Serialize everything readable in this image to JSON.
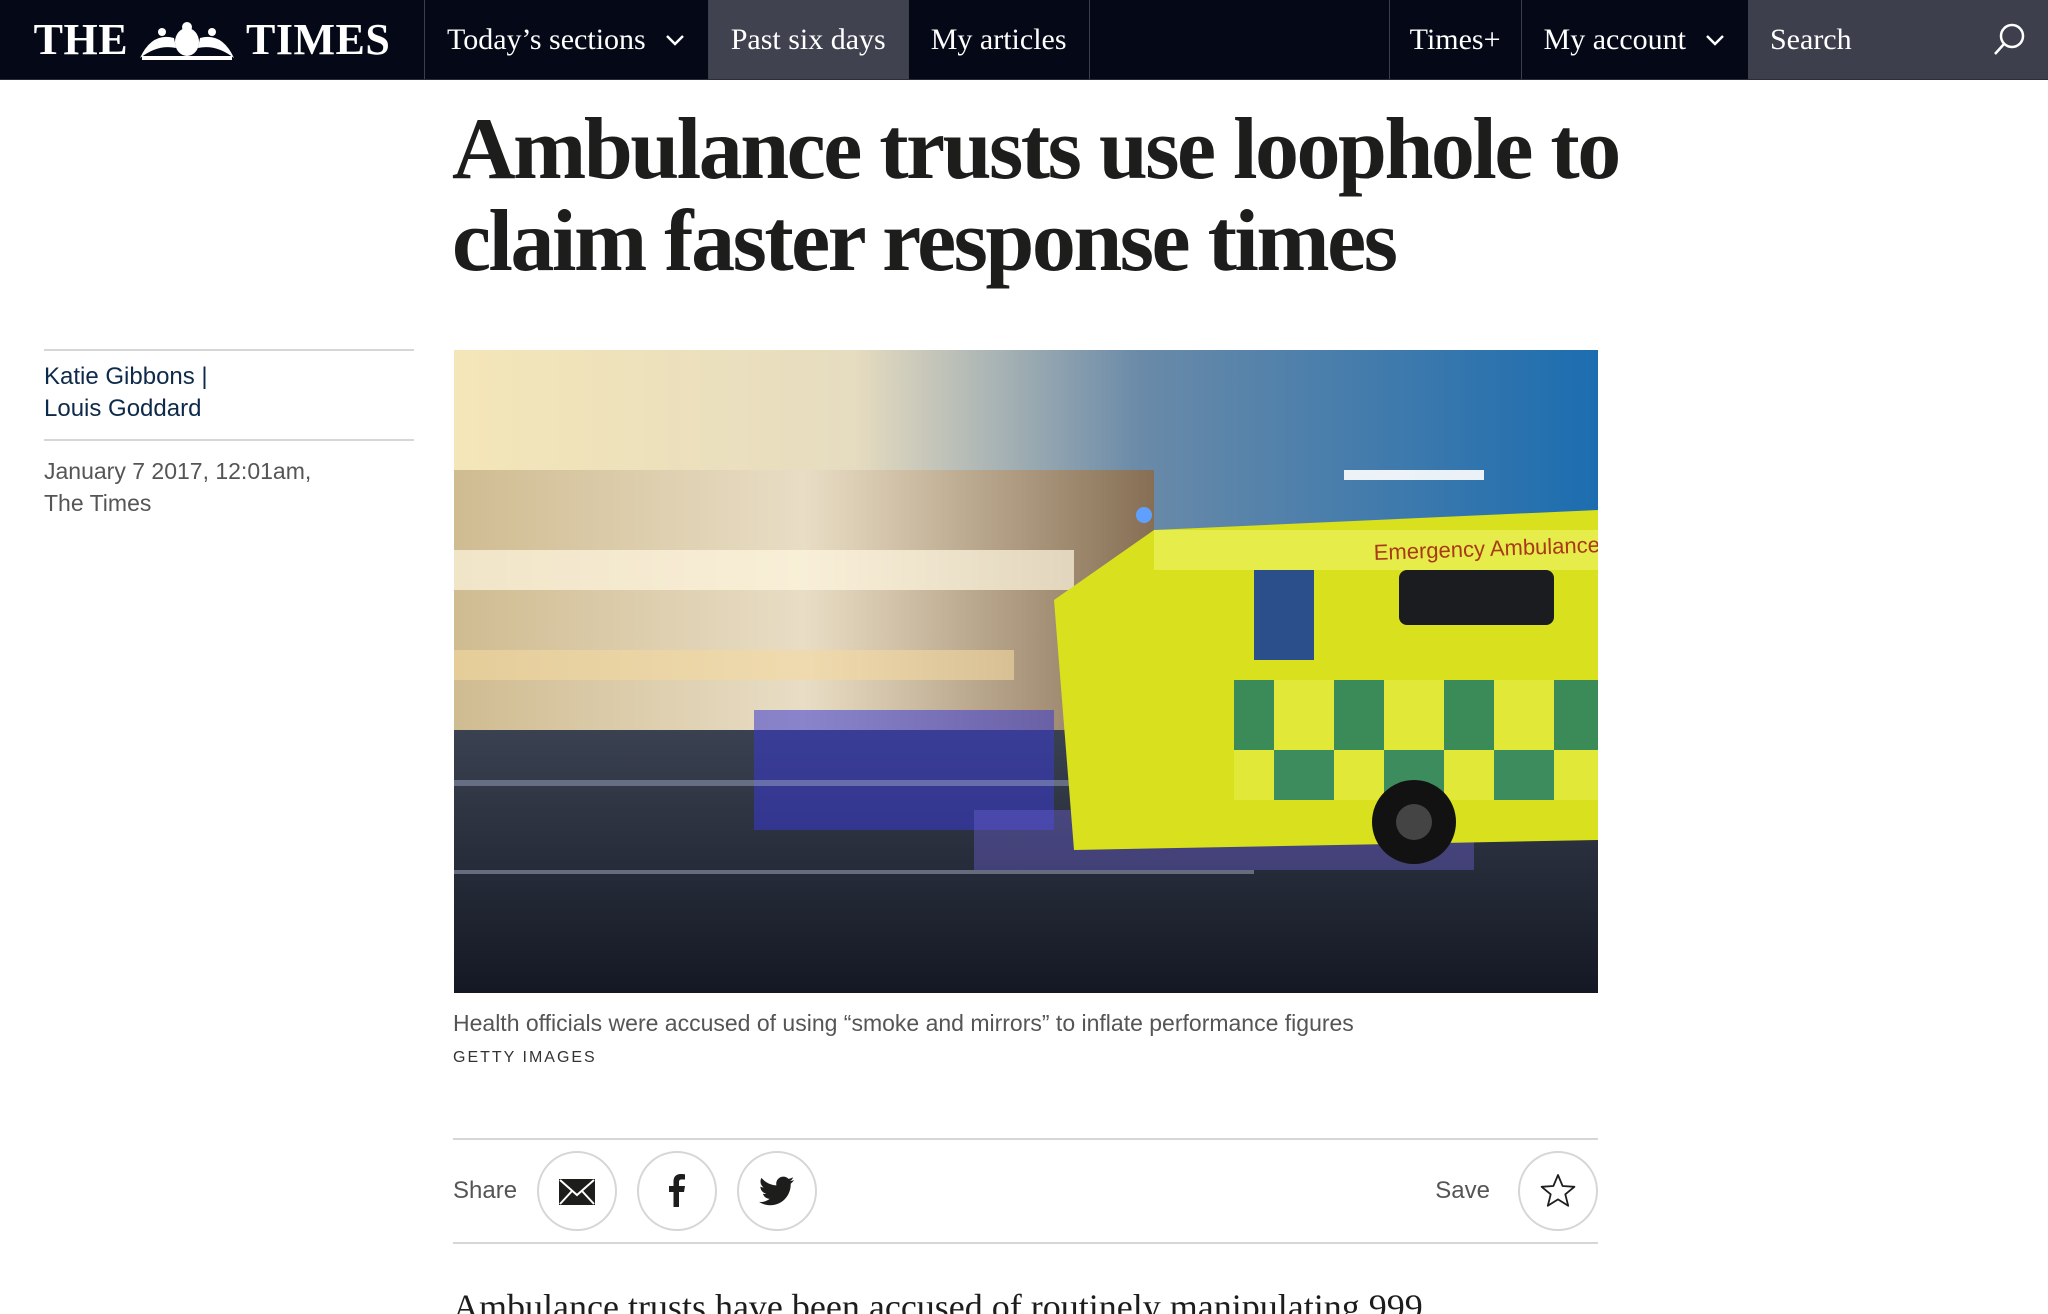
{
  "nav": {
    "logo": "THE TIMES",
    "logo_left": "THE",
    "logo_right": "TIMES",
    "todays_sections": "Today’s sections",
    "past_six_days": "Past six days",
    "my_articles": "My articles",
    "times_plus": "Times+",
    "my_account": "My account",
    "search": "Search"
  },
  "article": {
    "headline": "Ambulance trusts use loophole to claim faster response times",
    "authors": [
      "Katie Gibbons |",
      "Louis Goddard"
    ],
    "date": "January 7 2017, 12:01am,",
    "publication": "The Times",
    "image": {
      "alt": "Emergency ambulance speeding through a city street at night",
      "vehicle_text": "Emergency Ambulance",
      "caption": "Health officials were accused of using “smoke and mirrors” to inflate performance figures",
      "credit": "GETTY IMAGES"
    },
    "share_label": "Share",
    "save_label": "Save",
    "lede": "Ambulance trusts have been accused of routinely manipulating 999"
  },
  "colors": {
    "nav_background": "#050817",
    "nav_active": "#40434f",
    "byline_link": "#0e2a4a"
  },
  "icons": [
    "chevron-down-icon",
    "search-icon",
    "email-icon",
    "facebook-icon",
    "twitter-icon",
    "star-icon"
  ]
}
